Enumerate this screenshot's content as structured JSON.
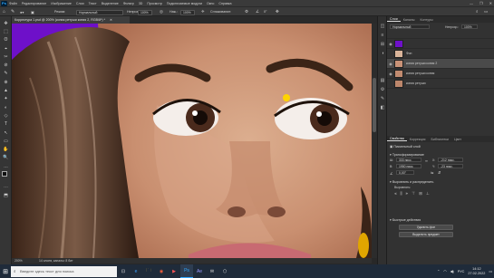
{
  "menu": {
    "logo": "Ps",
    "items": [
      "Файл",
      "Редактирование",
      "Изображение",
      "Слои",
      "Текст",
      "Выделение",
      "Фильтр",
      "3D",
      "Просмотр",
      "Подключаемые модули",
      "Окно",
      "Справка"
    ],
    "window_controls": [
      "—",
      "❐",
      "✕"
    ]
  },
  "options_bar": {
    "mode_label": "Режим:",
    "mode_value": "Нормальный",
    "opacity_label": "Непрозр.:",
    "opacity_value": "100%",
    "flow_label": "Наж.:",
    "flow_value": "100%",
    "smoothing_label": "Сглаживание:",
    "angle_value": "0°"
  },
  "document": {
    "tab_title": "Корректура 1.psd @ 200% (копия ретуши копия 2, RGB/8*) *",
    "tab_close": "✕"
  },
  "status": {
    "zoom": "200%",
    "doc_info": "14 слоев, каналы: 8 бит"
  },
  "tools": [
    "✥",
    "⬚",
    "ʘ",
    "⌖",
    "✂",
    "⊘",
    "✎",
    "⊕",
    "▲",
    "✦",
    "◐",
    "◇",
    "T",
    "↖",
    "▭",
    "✋",
    "🔍",
    "…",
    "◼",
    "⋯",
    "⬒"
  ],
  "panel_icons": [
    "◫",
    "≡",
    "⊞",
    "◑",
    "▤",
    "⚙",
    "✎",
    "◧"
  ],
  "layers_panel": {
    "tabs": [
      "Слои",
      "Каналы",
      "Контуры"
    ],
    "blend_mode": "Нормальный",
    "opacity_label": "Непрозр.:",
    "opacity_value": "100%",
    "rows": [
      {
        "name": "",
        "thumb": "#6e10c9",
        "selected": false
      },
      {
        "name": "Фон",
        "thumb": "#d9b49a",
        "selected": false
      },
      {
        "name": "копия ретуши копия 2",
        "thumb": "#c99277",
        "selected": true
      },
      {
        "name": "копия ретуши копия",
        "thumb": "#c18b70",
        "selected": false
      },
      {
        "name": "копия ретуши",
        "thumb": "#bc866b",
        "selected": false
      }
    ]
  },
  "properties_panel": {
    "tabs": [
      "Свойства",
      "Коррекция",
      "Библиотеки",
      "Цвет"
    ],
    "layer_type": "Пиксельный слой",
    "transform_title": "Трансформирование",
    "w_label": "Ш:",
    "w_value": "333 пикс.",
    "x_label": "X:",
    "x_value": "-212 пикс.",
    "h_label": "В:",
    "h_value": "1950 пикс.",
    "y_label": "Y:",
    "y_value": "-23 пикс.",
    "angle_value": "0,00°",
    "align_title": "Выровнять и распределить",
    "align_sub": "Выровнять:",
    "quick_title": "Быстрые действия",
    "btn_remove_bg": "Удалить фон",
    "btn_select_subject": "Выделить предмет"
  },
  "taskbar": {
    "start_icon": "windows-logo",
    "search_placeholder": "Введите здесь текст для поиска",
    "apps": [
      "⊡",
      "e",
      "🗀",
      "◉",
      "▶",
      "Ps",
      "Ae",
      "✉",
      "⬡"
    ],
    "time": "14:12",
    "date": "27.02.2022",
    "lang": "РУС"
  },
  "colors": {
    "canvas_bg": "#6e10c9",
    "ps_blue": "#31a8ff",
    "panel_bg": "#323232"
  }
}
